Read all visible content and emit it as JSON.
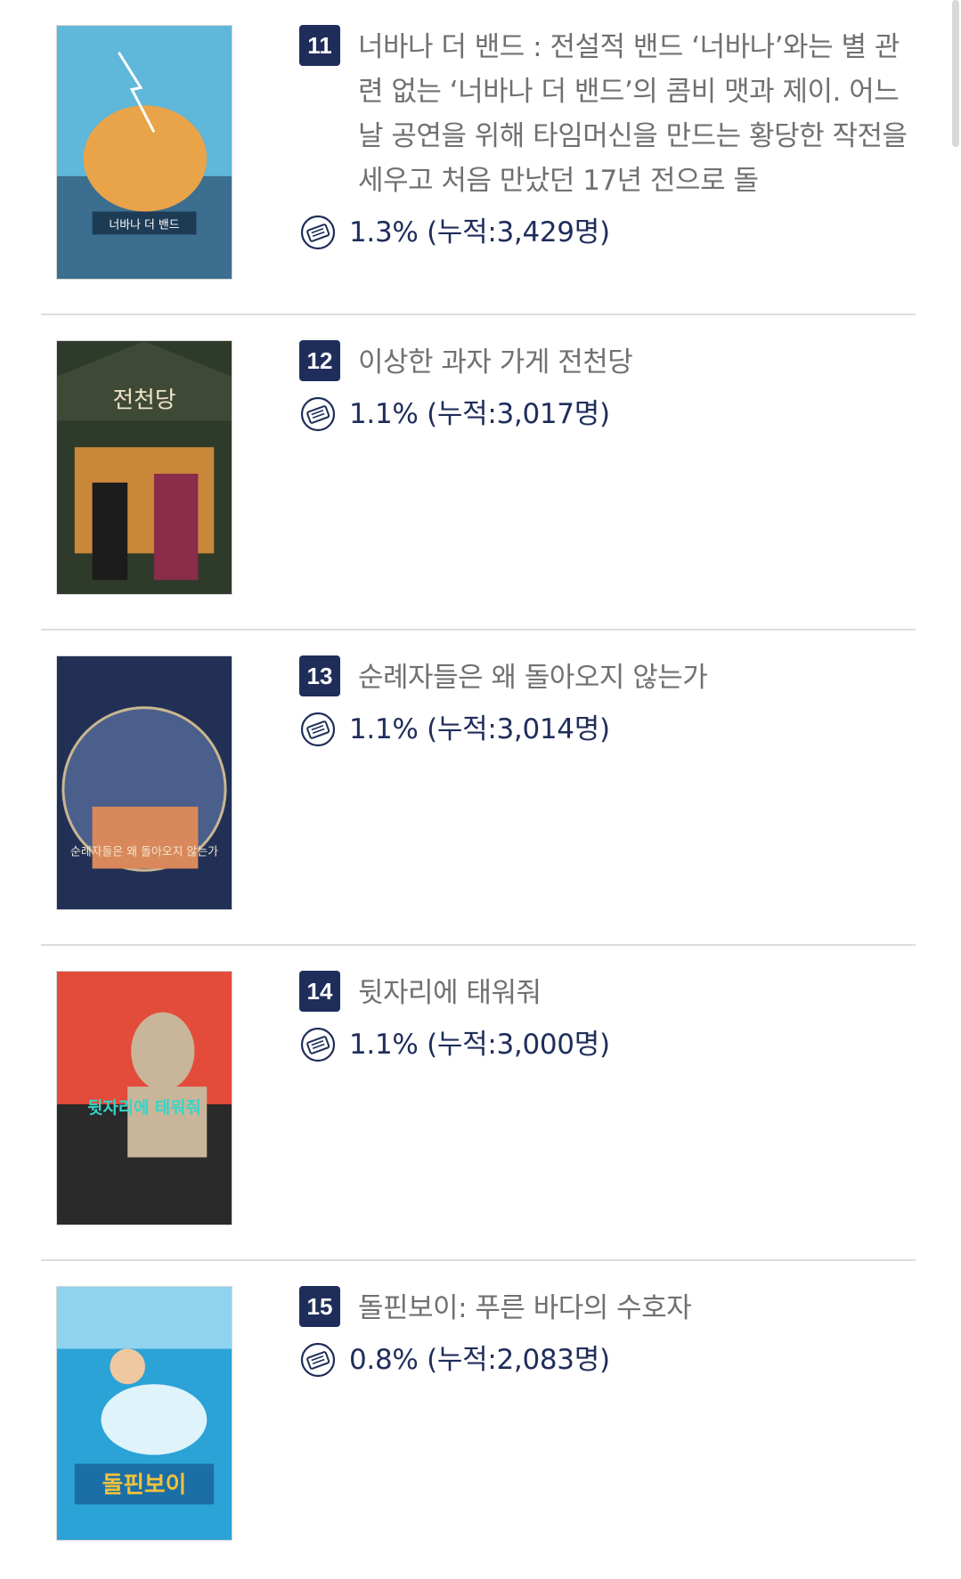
{
  "movies": [
    {
      "rank": "11",
      "title": "너바나 더 밴드 : 전설적 밴드 ‘너바나’와는 별 관련 없는 ‘너바나 더 밴드’의 콤비 맷과 제이. 어느 날 공연을 위해 타임머신을 만드는 황당한 작전을 세우고 처음 만났던 17년 전으로 돌",
      "stat": "1.3% (누적:3,429명)",
      "poster_text": "너바나 더 밴드",
      "poster_colors": [
        "#5fb7d9",
        "#e9a349",
        "#3b6e8f"
      ]
    },
    {
      "rank": "12",
      "title": "이상한 과자 가게 전천당",
      "stat": "1.1% (누적:3,017명)",
      "poster_text": "전천당",
      "poster_colors": [
        "#2f3b2a",
        "#c9873a",
        "#8a2c4a"
      ]
    },
    {
      "rank": "13",
      "title": "순례자들은 왜 돌아오지 않는가",
      "stat": "1.1% (누적:3,014명)",
      "poster_text": "순례자들은 왜 돌아오지 않는가",
      "poster_colors": [
        "#223056",
        "#d8885a",
        "#4b5f8c"
      ]
    },
    {
      "rank": "14",
      "title": "뒷자리에 태워줘",
      "stat": "1.1% (누적:3,000명)",
      "poster_text": "뒷자리에 태워줘",
      "poster_colors": [
        "#e34b3a",
        "#2a2a2a",
        "#c9b59a"
      ]
    },
    {
      "rank": "15",
      "title": "돌핀보이: 푸른 바다의 수호자",
      "stat": "0.8% (누적:2,083명)",
      "poster_text": "돌핀보이",
      "poster_colors": [
        "#2ba3d6",
        "#f3c23a",
        "#8fd3ef"
      ]
    }
  ],
  "ticket_icon": "ticket-icon",
  "colors": {
    "rank_badge": "#1f2d5a",
    "stat_text": "#1f2d5a",
    "title_text": "#707070",
    "divider": "#dcdcdc"
  }
}
